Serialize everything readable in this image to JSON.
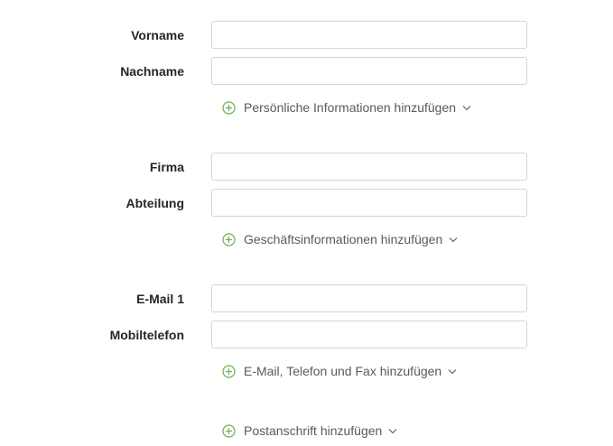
{
  "sections": {
    "personal": {
      "firstname_label": "Vorname",
      "firstname_value": "",
      "lastname_label": "Nachname",
      "lastname_value": "",
      "add_label": "Persönliche Informationen hinzufügen"
    },
    "business": {
      "company_label": "Firma",
      "company_value": "",
      "department_label": "Abteilung",
      "department_value": "",
      "add_label": "Geschäftsinformationen hinzufügen"
    },
    "contact": {
      "email_label": "E-Mail 1",
      "email_value": "",
      "mobile_label": "Mobiltelefon",
      "mobile_value": "",
      "add_label": "E-Mail, Telefon und Fax hinzufügen"
    },
    "address": {
      "add_label": "Postanschrift hinzufügen"
    }
  },
  "icons": {
    "add": "plus-circle-icon",
    "expand": "chevron-down-icon"
  },
  "colors": {
    "accent_green": "#6ab04c",
    "label_text": "#262626",
    "link_text": "#5a5a5a",
    "input_border": "#d5d5d5"
  }
}
